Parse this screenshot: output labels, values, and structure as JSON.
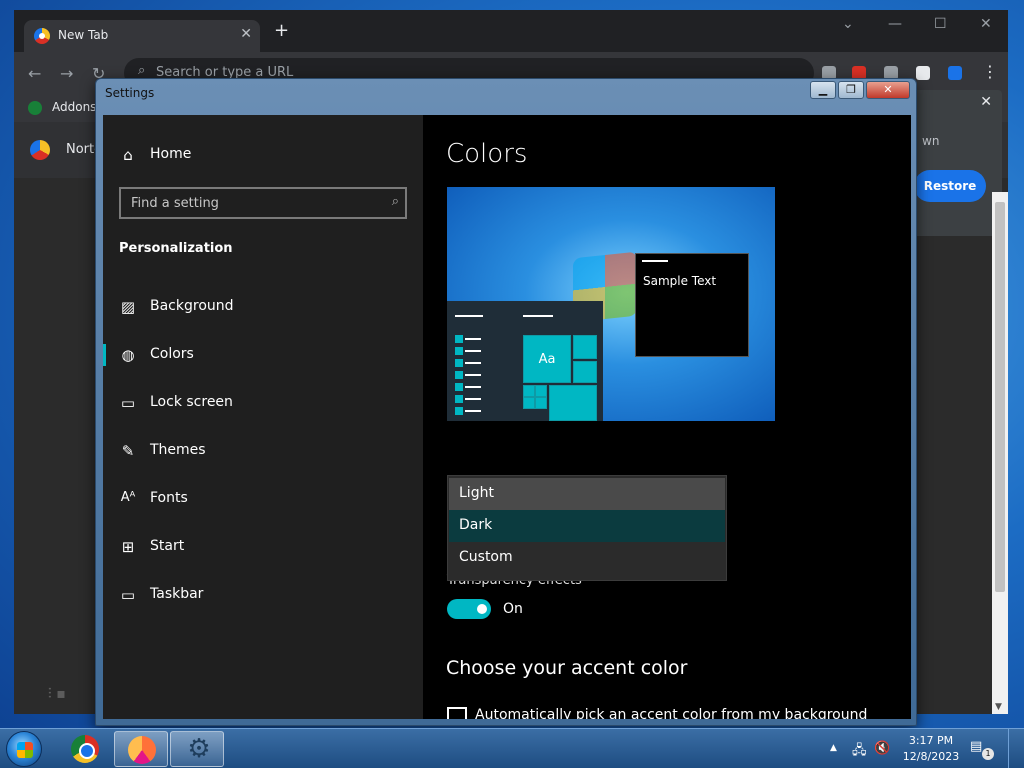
{
  "browser": {
    "tab_title": "New Tab",
    "tab_close": "✕",
    "new_tab": "+",
    "omnibox_placeholder": "Search or type a URL",
    "bookmark_label": "Addons",
    "ntp_item_label": "Norton",
    "popup_text": "wn",
    "restore_label": "Restore"
  },
  "settings": {
    "window_title": "Settings",
    "nav": {
      "home": "Home",
      "search_placeholder": "Find a setting",
      "section": "Personalization",
      "items": [
        {
          "label": "Background",
          "icon": "picture-icon"
        },
        {
          "label": "Colors",
          "icon": "palette-icon"
        },
        {
          "label": "Lock screen",
          "icon": "lock-screen-icon"
        },
        {
          "label": "Themes",
          "icon": "themes-icon"
        },
        {
          "label": "Fonts",
          "icon": "fonts-icon"
        },
        {
          "label": "Start",
          "icon": "start-icon"
        },
        {
          "label": "Taskbar",
          "icon": "taskbar-icon"
        }
      ],
      "selected": "Colors"
    },
    "content": {
      "title": "Colors",
      "preview_sample_text": "Sample Text",
      "preview_tile_text": "Aa",
      "mode_options": [
        "Light",
        "Dark",
        "Custom"
      ],
      "mode_hovered": "Light",
      "mode_selected": "Dark",
      "transparency_label": "Transparency effects",
      "transparency_state": "On",
      "accent_heading": "Choose your accent color",
      "auto_accent_label": "Automatically pick an accent color from my background"
    }
  },
  "taskbar": {
    "time": "3:17 PM",
    "date": "12/8/2023",
    "notification_count": "1"
  },
  "colors": {
    "accent": "#00b7c3",
    "nav_bg": "#1f1f1f",
    "content_bg": "#000000"
  }
}
